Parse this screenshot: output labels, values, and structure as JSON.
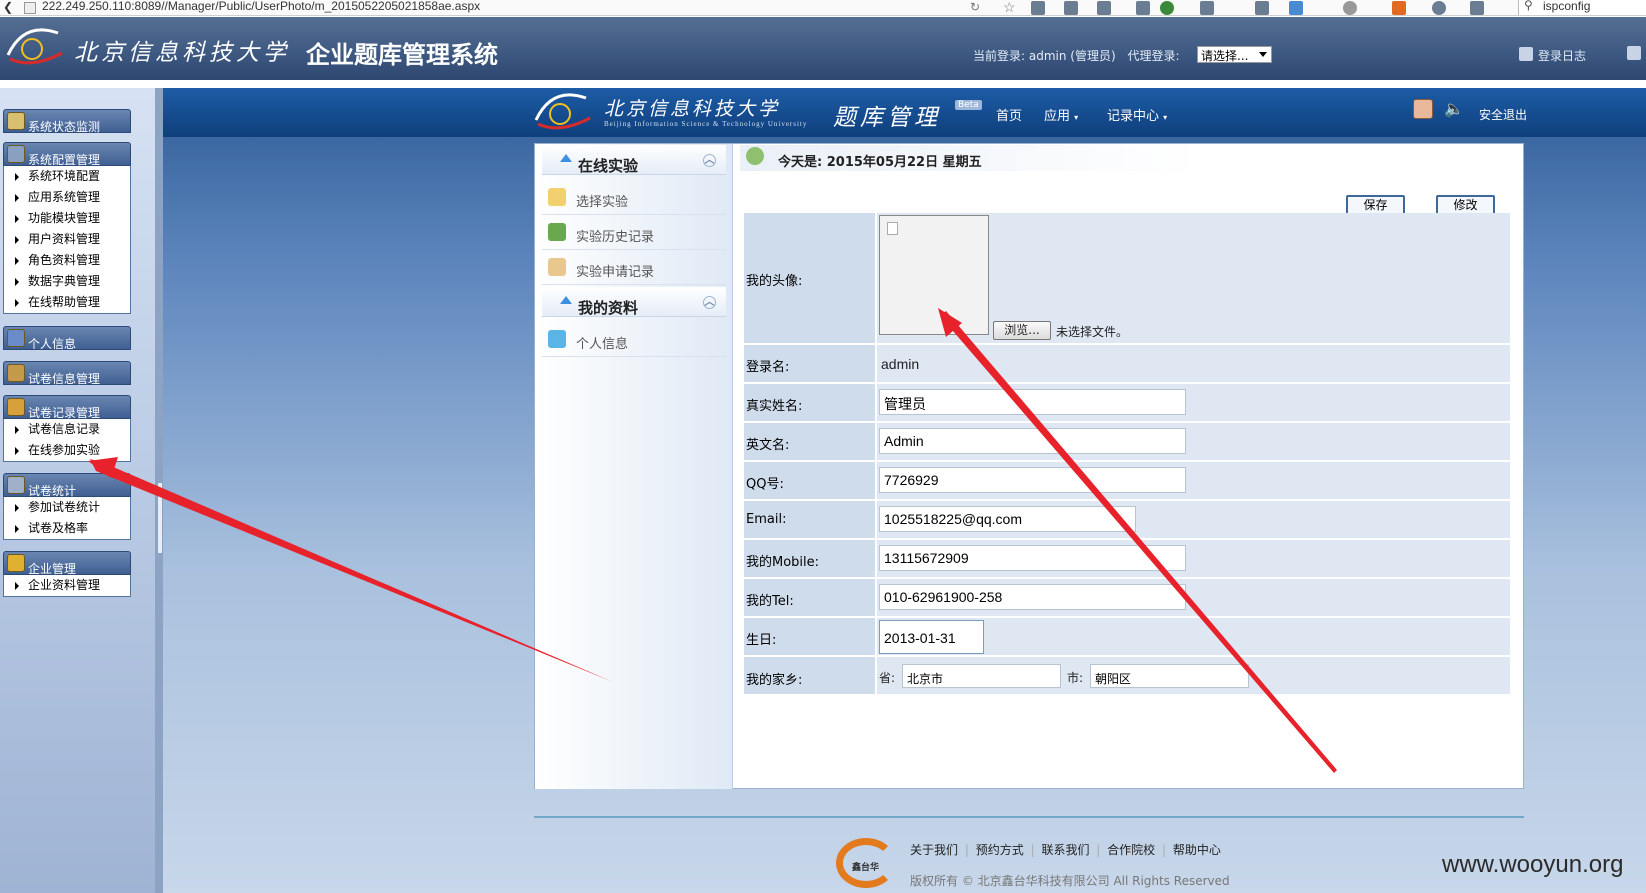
{
  "browser": {
    "url": "222.249.250.110:8089//Manager/Public/UserPhoto/m_2015052205021858ae.aspx",
    "search_value": "ispconfig"
  },
  "header": {
    "school_name": "北京信息科技大学",
    "system_name": "企业题库管理系统",
    "current_login": "当前登录: admin (管理员)",
    "proxy_login_label": "代理登录:",
    "proxy_select_value": "请选择...",
    "login_log": "登录日志"
  },
  "sidebar": {
    "groups": [
      {
        "title": "系统状态监测",
        "items": []
      },
      {
        "title": "系统配置管理",
        "items": [
          "系统环境配置",
          "应用系统管理",
          "功能模块管理",
          "用户资料管理",
          "角色资料管理",
          "数据字典管理",
          "在线帮助管理"
        ]
      },
      {
        "title": "个人信息",
        "items": []
      },
      {
        "title": "试卷信息管理",
        "items": []
      },
      {
        "title": "试卷记录管理",
        "items": [
          "试卷信息记录",
          "在线参加实验"
        ]
      },
      {
        "title": "试卷统计",
        "items": [
          "参加试卷统计",
          "试卷及格率"
        ]
      },
      {
        "title": "企业管理",
        "items": [
          "企业资料管理"
        ]
      }
    ]
  },
  "inner_header": {
    "school_name": "北京信息科技大学",
    "school_english": "Beijing Information Science & Technology University",
    "app_title": "题库管理",
    "beta": "Beta",
    "nav_home": "首页",
    "nav_apps": "应用",
    "nav_records": "记录中心",
    "logout": "安全退出"
  },
  "left_nav": {
    "section1": "在线实验",
    "section1_items": [
      "选择实验",
      "实验历史记录",
      "实验申请记录"
    ],
    "section2": "我的资料",
    "section2_items": [
      "个人信息"
    ]
  },
  "content": {
    "today": "今天是: 2015年05月22日  星期五",
    "save_button": "保存",
    "edit_button": "修改",
    "avatar_label": "我的头像:",
    "browse_button": "浏览...",
    "no_file": "未选择文件。",
    "fields": {
      "login_label": "登录名:",
      "login_value": "admin",
      "realname_label": "真实姓名:",
      "realname_value": "管理员",
      "english_label": "英文名:",
      "english_value": "Admin",
      "qq_label": "QQ号:",
      "qq_value": "7726929",
      "email_label": "Email:",
      "email_value": "1025518225@qq.com",
      "mobile_label": "我的Mobile:",
      "mobile_value": "13115672909",
      "tel_label": "我的Tel:",
      "tel_value": "010-62961900-258",
      "birthday_label": "生日:",
      "birthday_value": "2013-01-31",
      "hometown_label": "我的家乡:",
      "province_label": "省:",
      "province_value": "北京市",
      "city_label": "市:",
      "city_value": "朝阳区"
    }
  },
  "footer": {
    "links": [
      "关于我们",
      "预约方式",
      "联系我们",
      "合作院校",
      "帮助中心"
    ],
    "copyright": "版权所有 © 北京鑫台华科技有限公司   All Rights Reserved",
    "logo_text": "鑫台华"
  },
  "watermark": "www.wooyun.org",
  "colors": {
    "annotation_arrow": "#e8222a",
    "header_blue": "#1d5ca6"
  }
}
